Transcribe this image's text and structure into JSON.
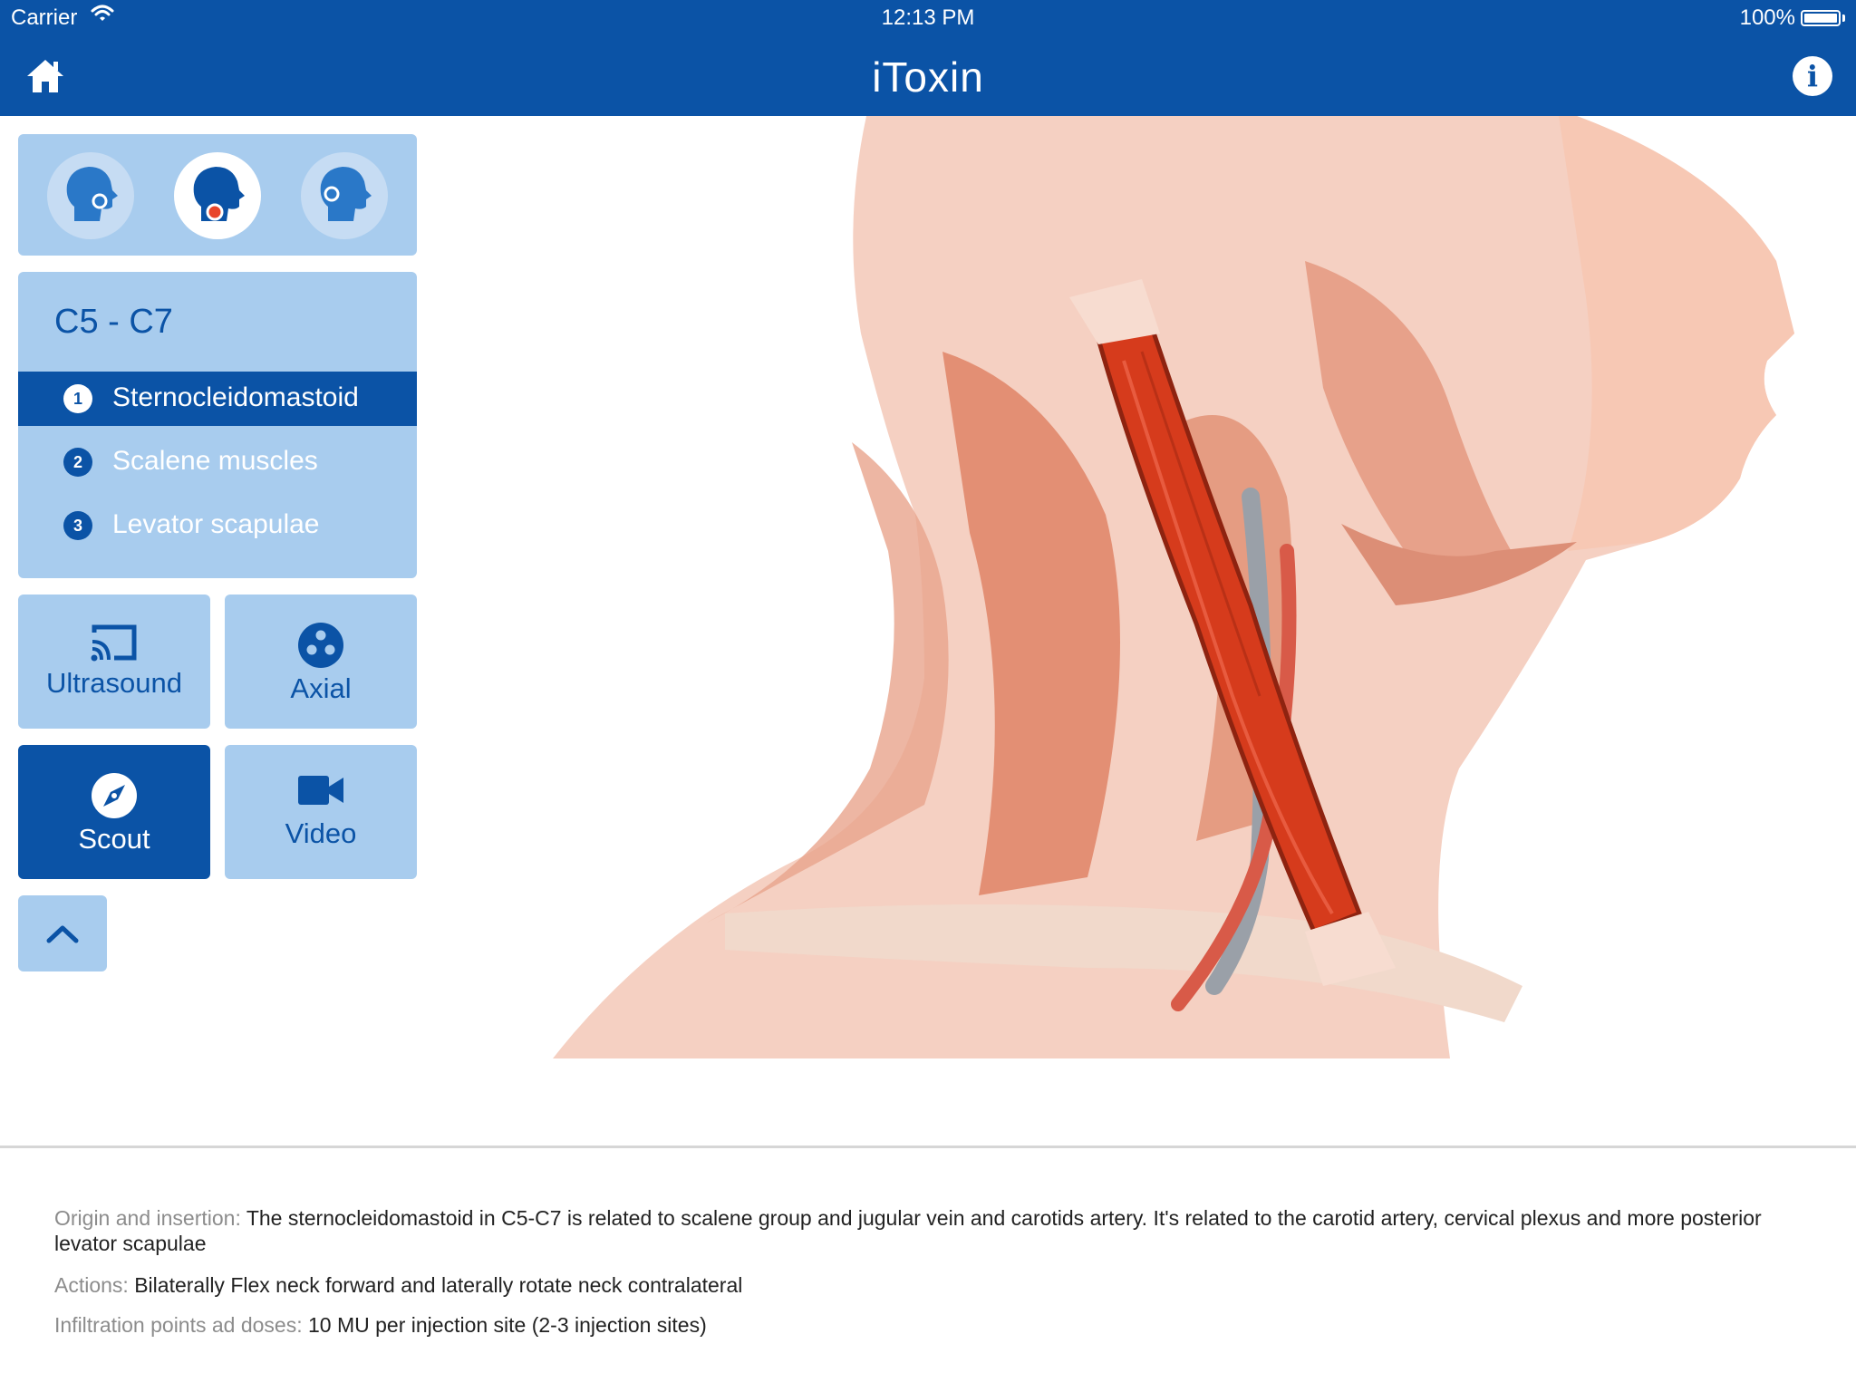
{
  "status_bar": {
    "carrier": "Carrier",
    "time": "12:13 PM",
    "battery": "100%"
  },
  "nav": {
    "title": "iToxin",
    "home_icon": "home-icon",
    "info_icon": "info-icon"
  },
  "colors": {
    "brand": "#0b53a6",
    "panel": "#a8ccee",
    "highlight_muscle": "#d63b1c"
  },
  "view_selector": {
    "views": [
      {
        "name": "head-posterior-view",
        "active": false
      },
      {
        "name": "head-lateral-view",
        "active": true
      },
      {
        "name": "head-anterior-view",
        "active": false
      }
    ]
  },
  "level": {
    "title": "C5 - C7",
    "muscles": [
      {
        "number": "1",
        "label": "Sternocleidomastoid",
        "selected": true
      },
      {
        "number": "2",
        "label": "Scalene muscles",
        "selected": false
      },
      {
        "number": "3",
        "label": "Levator scapulae",
        "selected": false
      }
    ]
  },
  "modes": {
    "ultrasound": "Ultrasound",
    "axial": "Axial",
    "scout": "Scout",
    "video": "Video",
    "active": "Scout"
  },
  "details": {
    "origin_label": "Origin and insertion:",
    "origin_text": "The sternocleidomastoid in C5-C7 is related to scalene group and jugular vein and carotids artery. It's related to the carotid artery, cervical plexus and more posterior levator scapulae",
    "actions_label": "Actions:",
    "actions_text": "Bilaterally Flex neck forward and laterally rotate neck contralateral",
    "infiltration_label": "Infiltration points ad doses:",
    "infiltration_text": "10 MU per injection site (2-3 injection sites)"
  }
}
